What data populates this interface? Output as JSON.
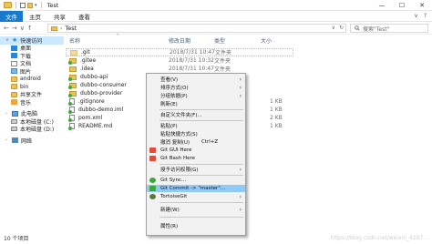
{
  "window": {
    "title": "Test",
    "controls": {
      "minimize": "—",
      "maximize": "☐",
      "close": "✕"
    }
  },
  "ribbon": {
    "file": "文件",
    "tabs": [
      "主页",
      "共享",
      "查看"
    ],
    "right": [
      "∨",
      "?"
    ]
  },
  "address": {
    "nav": [
      "←",
      "→",
      "∨",
      "↑"
    ],
    "path": "Test",
    "sep": "›",
    "right": [
      "∨",
      "↻"
    ],
    "search_placeholder": "搜索\"Test\"",
    "search_icon": "search-icon"
  },
  "sidebar": {
    "items": [
      {
        "label": "快速访问",
        "icon": "star-icon",
        "level": 1,
        "chev": "∨",
        "selected": true
      },
      {
        "label": "桌面",
        "icon": "desktop-icon",
        "level": 2
      },
      {
        "label": "下载",
        "icon": "download-icon",
        "level": 2
      },
      {
        "label": "文档",
        "icon": "document-icon",
        "level": 2
      },
      {
        "label": "图片",
        "icon": "picture-icon",
        "level": 2
      },
      {
        "label": "android",
        "icon": "folder-icon",
        "level": 2
      },
      {
        "label": "bin",
        "icon": "folder-icon",
        "level": 2
      },
      {
        "label": "共享文件",
        "icon": "folder-icon",
        "level": 2
      },
      {
        "label": "音乐",
        "icon": "music-icon",
        "level": 2
      },
      {
        "label": "此电脑",
        "icon": "computer-icon",
        "level": 1,
        "chev": "›"
      },
      {
        "label": "本地磁盘 (C:)",
        "icon": "drive-icon",
        "level": 2
      },
      {
        "label": "本地磁盘 (D:)",
        "icon": "drive-icon",
        "level": 2
      },
      {
        "label": "网络",
        "icon": "network-icon",
        "level": 1,
        "chev": "›"
      }
    ]
  },
  "columns": {
    "name": "名称",
    "date": "修改日期",
    "type": "类型",
    "size": "大小",
    "sort_arrow": "^"
  },
  "files": [
    {
      "name": ".git",
      "date": "2018/7/31 10:47",
      "type": "文件夹",
      "size": "",
      "icon": "git-folder-icon"
    },
    {
      "name": ".gitee",
      "date": "2018/7/31 10:32",
      "type": "文件夹",
      "size": "",
      "icon": "git-folder-icon"
    },
    {
      "name": ".idea",
      "date": "2018/7/31 10:47",
      "type": "文件夹",
      "size": "",
      "icon": "folder-icon"
    },
    {
      "name": "dubbo-api",
      "date": "",
      "type": "",
      "size": "",
      "icon": "folder-icon"
    },
    {
      "name": "dubbo-consumer",
      "date": "",
      "type": "",
      "size": "",
      "icon": "folder-icon"
    },
    {
      "name": "dubbo-provider",
      "date": "",
      "type": "",
      "size": "",
      "icon": "folder-icon"
    },
    {
      "name": ".gitignore",
      "date": "",
      "type": "",
      "size": "1 KB",
      "icon": "file-icon"
    },
    {
      "name": "dubbo-demo.iml",
      "date": "",
      "type": "",
      "size": "1 KB",
      "icon": "file-icon"
    },
    {
      "name": "pom.xml",
      "date": "",
      "type": "",
      "size": "2 KB",
      "icon": "file-icon"
    },
    {
      "name": "README.md",
      "date": "",
      "type": "",
      "size": "1 KB",
      "icon": "file-icon"
    }
  ],
  "context_menu": {
    "items": [
      {
        "label": "查看(V)",
        "arrow": "›"
      },
      {
        "label": "排序方式(O)",
        "arrow": "›"
      },
      {
        "label": "分组依据(P)",
        "arrow": "›"
      },
      {
        "label": "刷新(E)",
        "arrow": ""
      },
      {
        "label": "自定义文件夹(F)...",
        "arrow": ""
      },
      {
        "label": "粘贴(P)",
        "arrow": ""
      },
      {
        "label": "粘贴快捷方式(S)",
        "arrow": ""
      },
      {
        "label": "撤消 复制(U)",
        "shortcut": "Ctrl+Z",
        "arrow": ""
      },
      {
        "label": "Git GUI Here",
        "arrow": "",
        "icon": "git-gui-icon"
      },
      {
        "label": "Git Bash Here",
        "arrow": "",
        "icon": "git-bash-icon"
      },
      {
        "label": "授予访问权限(G)",
        "arrow": "›"
      },
      {
        "label": "Git Sync...",
        "arrow": "",
        "icon": "git-sync-icon"
      },
      {
        "label": "Git Commit -> \"master\"...",
        "arrow": "",
        "icon": "git-commit-icon",
        "highlight": true
      },
      {
        "label": "TortoiseGit",
        "arrow": "›",
        "icon": "tortoisegit-icon"
      },
      {
        "label": "新建(W)",
        "arrow": "›"
      },
      {
        "label": "属性(R)",
        "arrow": ""
      }
    ]
  },
  "status": {
    "count": "10 个项目",
    "watermark": "https://blog.csdn.net/weixin_4287..."
  }
}
